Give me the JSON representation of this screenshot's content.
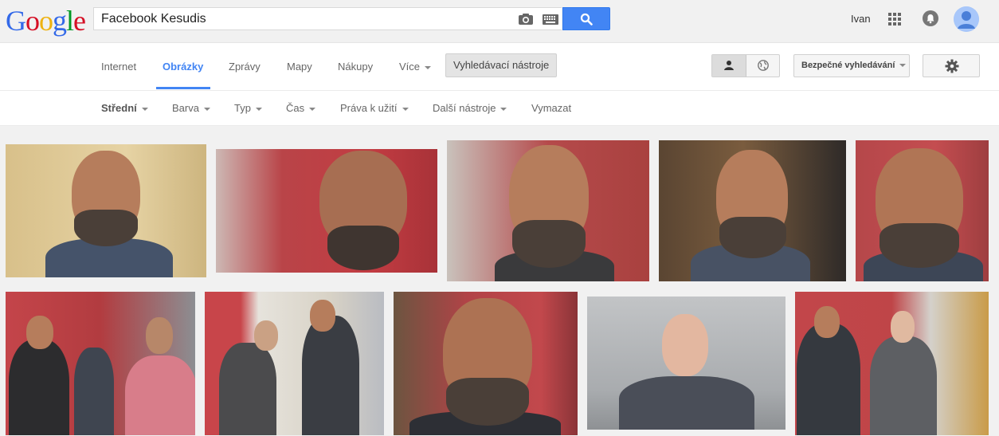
{
  "header": {
    "logo_letters": [
      "G",
      "o",
      "o",
      "g",
      "l",
      "e"
    ],
    "search_value": "Facebook Kesudis",
    "user_name": "Ivan",
    "icons": [
      "camera-icon",
      "keyboard-icon",
      "search-icon",
      "apps-grid-icon",
      "notifications-icon",
      "avatar-icon"
    ]
  },
  "nav": {
    "tabs": [
      {
        "label": "Internet",
        "active": false
      },
      {
        "label": "Obrázky",
        "active": true
      },
      {
        "label": "Zprávy",
        "active": false
      },
      {
        "label": "Mapy",
        "active": false
      },
      {
        "label": "Nákupy",
        "active": false
      },
      {
        "label": "Více",
        "active": false
      }
    ],
    "tools_button": "Vyhledávací nástroje",
    "safe_search": "Bezpečné vyhledávání",
    "accent": "#4285f4"
  },
  "tools": {
    "filters": [
      {
        "label": "Střední",
        "dropdown": true
      },
      {
        "label": "Barva",
        "dropdown": true
      },
      {
        "label": "Typ",
        "dropdown": true
      },
      {
        "label": "Čas",
        "dropdown": true
      },
      {
        "label": "Práva k užití",
        "dropdown": true
      },
      {
        "label": "Další nástroje",
        "dropdown": true
      },
      {
        "label": "Vymazat",
        "dropdown": false
      }
    ]
  },
  "results": {
    "row1_count": 5,
    "row2_count": 5
  }
}
